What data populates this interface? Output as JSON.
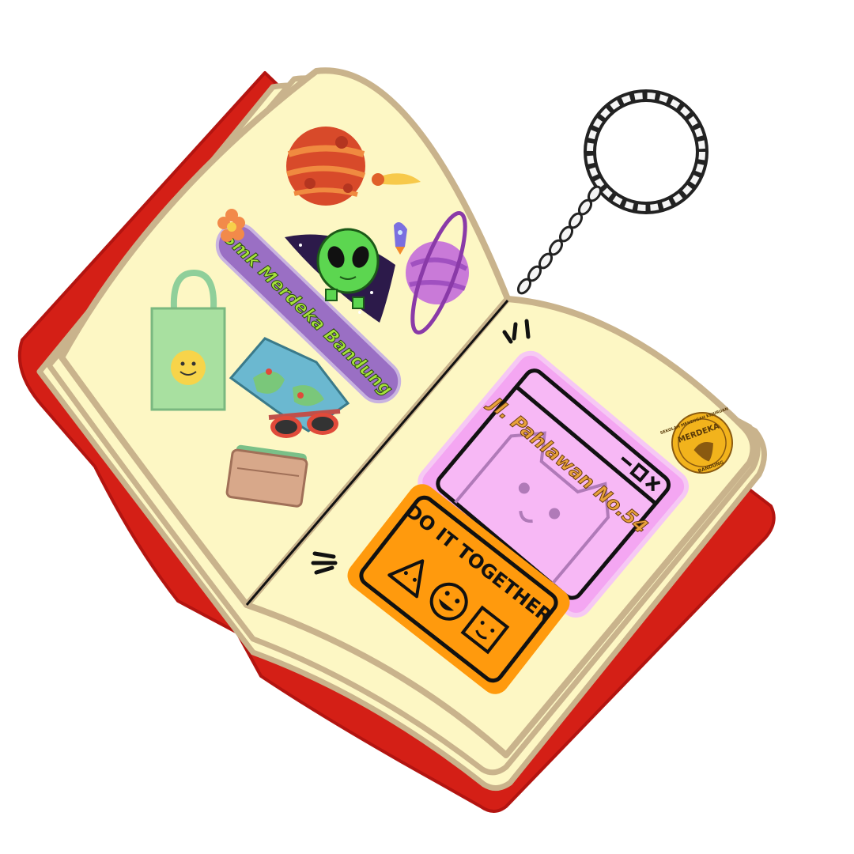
{
  "stickers": {
    "school_band": {
      "text": "Smk Merdeka Bandung"
    },
    "window_sticker": {
      "text": "Jl. Pahlawan No.54"
    },
    "slogan_sticker": {
      "text": "DO IT TOGETHER"
    },
    "school_seal": {
      "top_text": "SEKOLAH MENENGAH KEJURUAN",
      "middle_text": "MERDEKA",
      "bottom_text": "BANDUNG"
    }
  },
  "icons": [
    "red-planet-icon",
    "comet-icon",
    "flower-icon",
    "alien-ufo-icon",
    "rocket-icon",
    "ringed-planet-icon",
    "tote-bag-icon",
    "map-icon",
    "sunglasses-icon",
    "wallet-icon",
    "keychain-ring-icon",
    "cat-icon",
    "triangle-face-icon",
    "smile-face-icon",
    "square-face-icon"
  ],
  "colors": {
    "cover": "#d41f16",
    "pages": "#fdf7c4",
    "page_edge": "#c9b38c",
    "band": "#9a6fc4",
    "band_text": "#a6e23a",
    "window_pink": "#f4a6f2",
    "window_text": "#e8a23a",
    "slogan_orange": "#ff9a0d",
    "seal_gold": "#f2b31c"
  }
}
